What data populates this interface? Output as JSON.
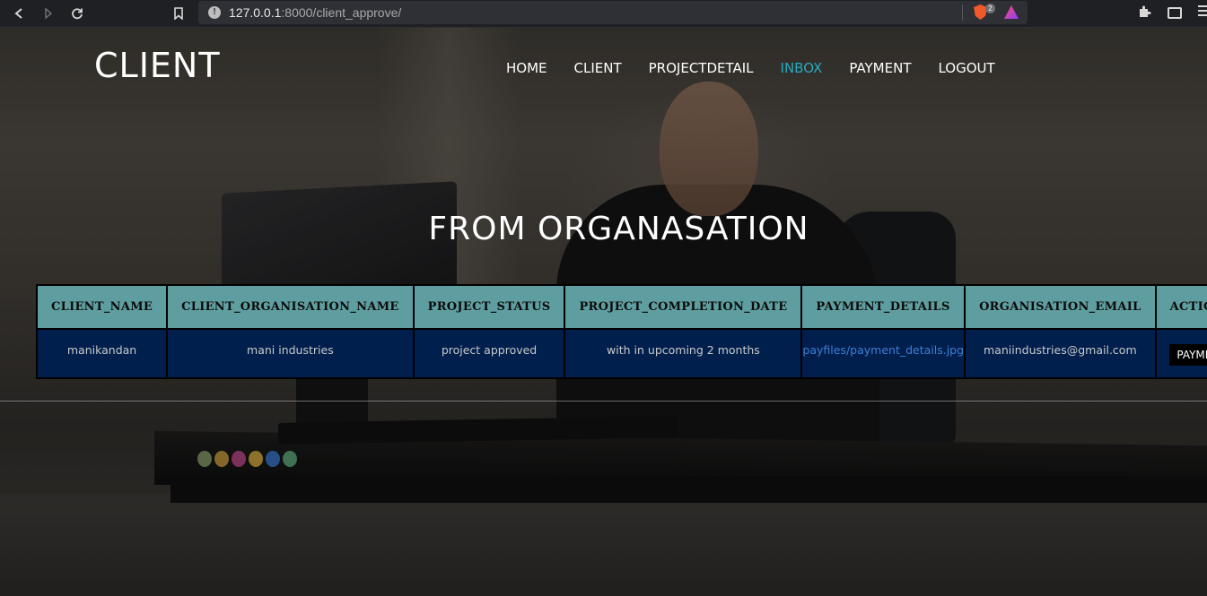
{
  "browser": {
    "url_host": "127.0.0.1",
    "url_path": ":8000/client_approve/",
    "shields_count": "2"
  },
  "site": {
    "brand": "CLIENT",
    "nav": [
      {
        "label": "HOME",
        "active": false
      },
      {
        "label": "CLIENT",
        "active": false
      },
      {
        "label": "PROJECTDETAIL",
        "active": false
      },
      {
        "label": "INBOX",
        "active": true
      },
      {
        "label": "PAYMENT",
        "active": false
      },
      {
        "label": "LOGOUT",
        "active": false
      }
    ],
    "active_nav_color": "#26a9bf"
  },
  "page": {
    "title": "FROM ORGANASATION"
  },
  "table": {
    "header_color": "#5f9ea0",
    "row_color": "#001f4d",
    "columns": [
      "CLIENT_NAME",
      "CLIENT_ORGANISATION_NAME",
      "PROJECT_STATUS",
      "PROJECT_COMPLETION_DATE",
      "PAYMENT_DETAILS",
      "ORGANISATION_EMAIL",
      "ACTIONS"
    ],
    "rows": [
      {
        "client_name": "manikandan",
        "organisation_name": "mani industries",
        "project_status": "project approved",
        "completion_date": "with in upcoming 2 months",
        "payment_details": "payfiles/payment_details.jpg",
        "organisation_email": "maniindustries@gmail.com",
        "action_label": "PAYMENT"
      }
    ]
  }
}
